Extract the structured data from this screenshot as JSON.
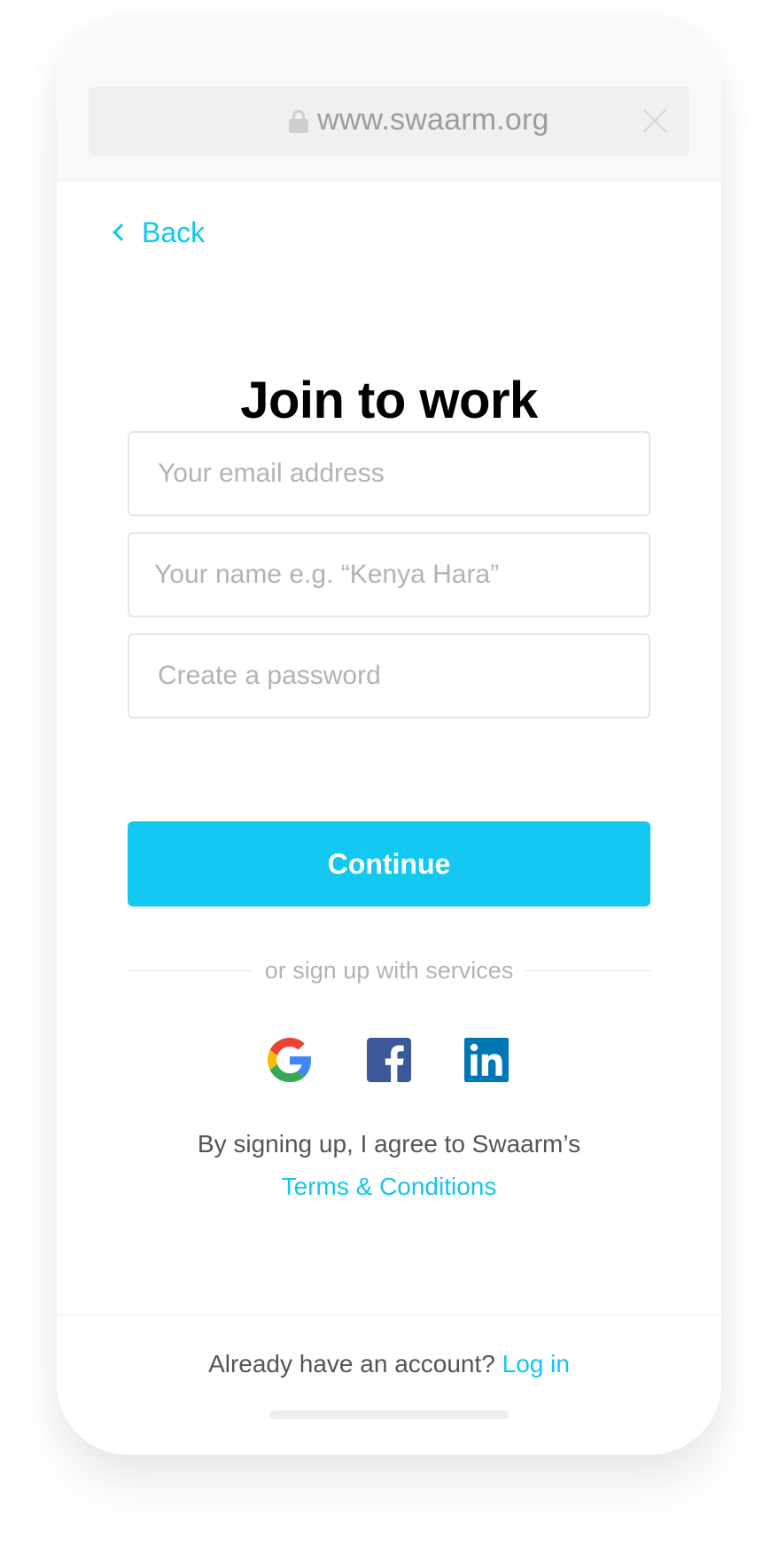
{
  "browser": {
    "url": "www.swaarm.org",
    "lock_icon": "lock-icon",
    "close_icon": "close-icon"
  },
  "nav": {
    "back_label": "Back",
    "back_icon": "chevron-left-icon"
  },
  "form": {
    "title": "Join to work",
    "email_placeholder": "Your email address",
    "name_placeholder": "Your name e.g. “Kenya Hara”",
    "password_placeholder": "Create a password",
    "continue_label": "Continue"
  },
  "services": {
    "divider_text": "or sign up with services",
    "providers": [
      "google-icon",
      "facebook-icon",
      "linkedin-icon"
    ]
  },
  "terms": {
    "text": "By signing up, I agree to Swaarm’s",
    "link": "Terms & Conditions"
  },
  "footer": {
    "question": "Already have an account?",
    "login_link": "Log in"
  },
  "colors": {
    "accent": "#13c8f0",
    "text": "#555555",
    "placeholder": "#b3b3b3"
  }
}
